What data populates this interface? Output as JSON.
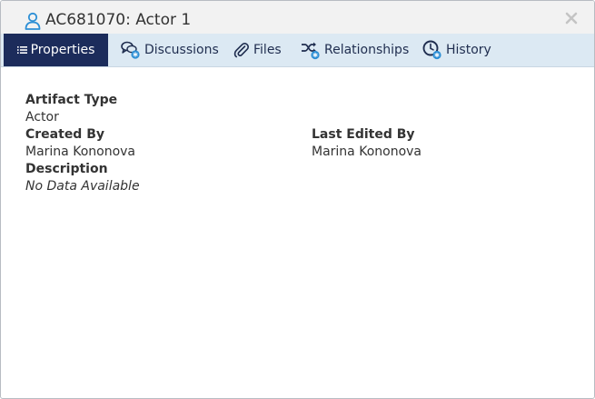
{
  "window": {
    "title": "AC681070: Actor 1"
  },
  "tabs": [
    {
      "label": "Properties",
      "icon": "list-icon",
      "active": true
    },
    {
      "label": "Discussions",
      "icon": "discussion-icon",
      "active": false
    },
    {
      "label": "Files",
      "icon": "paperclip-icon",
      "active": false
    },
    {
      "label": "Relationships",
      "icon": "relationships-icon",
      "active": false
    },
    {
      "label": "History",
      "icon": "history-icon",
      "active": false
    }
  ],
  "properties": {
    "artifact_type_label": "Artifact Type",
    "artifact_type_value": "Actor",
    "created_by_label": "Created By",
    "created_by_value": "Marina Kononova",
    "last_edited_by_label": "Last Edited By",
    "last_edited_by_value": "Marina Kononova",
    "description_label": "Description",
    "description_value": "No Data Available"
  },
  "colors": {
    "active_tab_bg": "#1c2c5b",
    "tabbar_bg": "#dce9f3",
    "accent_blue": "#2d8fd5"
  }
}
